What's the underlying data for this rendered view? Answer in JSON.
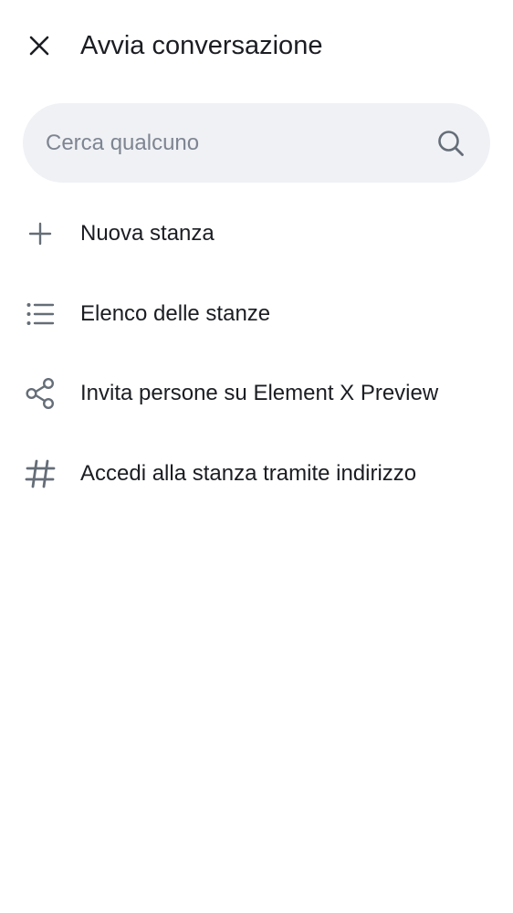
{
  "header": {
    "title": "Avvia conversazione",
    "close_icon": "close-icon"
  },
  "search": {
    "placeholder": "Cerca qualcuno",
    "value": "",
    "icon": "search-icon"
  },
  "menu": {
    "items": [
      {
        "label": "Nuova stanza",
        "icon": "plus-icon"
      },
      {
        "label": "Elenco delle stanze",
        "icon": "list-icon"
      },
      {
        "label": "Invita persone su Element X Preview",
        "icon": "share-icon"
      },
      {
        "label": "Accedi alla stanza tramite indirizzo",
        "icon": "hash-icon"
      }
    ]
  },
  "colors": {
    "background": "#ffffff",
    "text": "#1b1d22",
    "icon": "#656d77",
    "search_bg": "#eff1f5",
    "placeholder": "#7e8591"
  }
}
